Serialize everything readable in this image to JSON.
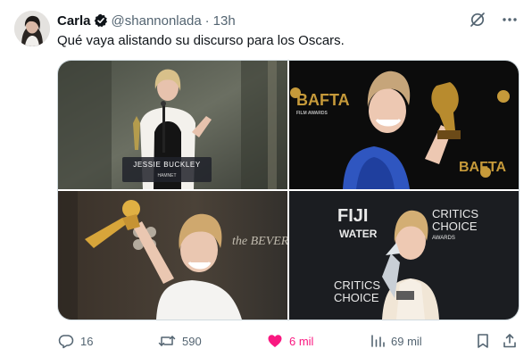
{
  "author": {
    "display_name": "Carla",
    "handle": "@shannonlada",
    "separator": "·",
    "time": "13h",
    "verified_badge_icon": "verified-badge-icon",
    "avatar_icon": "avatar"
  },
  "top_actions": [
    {
      "name": "grok-icon"
    },
    {
      "name": "more-icon"
    }
  ],
  "tweet": {
    "text": "Qué vaya alistando su discurso para los Oscars."
  },
  "media": {
    "photos": [
      {
        "name": "photo-golden-globes-speech",
        "caption": "JESSIE BUCKLEY",
        "sub_caption": "HAMNET"
      },
      {
        "name": "photo-bafta-awards",
        "bafta_text": "BAFTA",
        "bafta_sub": "FILM AWARDS"
      },
      {
        "name": "photo-golden-globe-trophy",
        "backdrop_text": "the BEVERLY H"
      },
      {
        "name": "photo-critics-choice-awards",
        "fiji_line1": "FIJI",
        "fiji_line2": "WATER",
        "cc_line1": "CRITICS",
        "cc_line2": "CHOICE",
        "cc_line3": "AWARDS"
      }
    ]
  },
  "stats": {
    "replies": "16",
    "reposts": "590",
    "likes": "6 mil",
    "views": "69 mil"
  },
  "colors": {
    "like_pink": "#f91880",
    "secondary_gray": "#536471",
    "text_dark": "#0f1419",
    "badge_gold_bg": "#0f1419"
  }
}
